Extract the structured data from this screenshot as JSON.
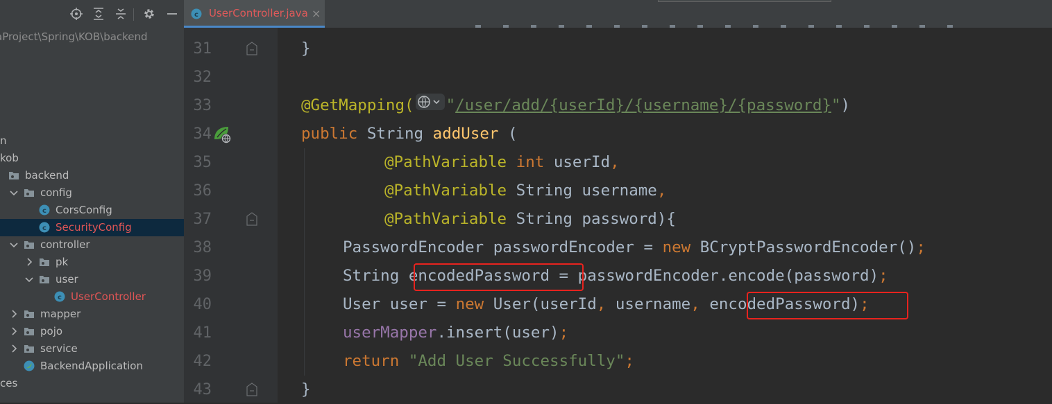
{
  "project_panel": {
    "root_path": "aProject\\Spring\\KOB\\backend",
    "tree": [
      {
        "label": "n",
        "indent": 0,
        "arrow": "none",
        "icon": "none",
        "selected": false,
        "error": false
      },
      {
        "label": "kob",
        "indent": 0,
        "arrow": "none",
        "icon": "none",
        "selected": false,
        "error": false
      },
      {
        "label": "backend",
        "indent": 0,
        "arrow": "none",
        "icon": "package",
        "selected": false,
        "error": false
      },
      {
        "label": "config",
        "indent": 1,
        "arrow": "expanded",
        "icon": "package",
        "selected": false,
        "error": false
      },
      {
        "label": "CorsConfig",
        "indent": 2,
        "arrow": "none",
        "icon": "class",
        "selected": false,
        "error": false
      },
      {
        "label": "SecurityConfig",
        "indent": 2,
        "arrow": "none",
        "icon": "class",
        "selected": true,
        "error": true
      },
      {
        "label": "controller",
        "indent": 1,
        "arrow": "expanded",
        "icon": "package",
        "selected": false,
        "error": false
      },
      {
        "label": "pk",
        "indent": 2,
        "arrow": "collapsed",
        "icon": "package",
        "selected": false,
        "error": false
      },
      {
        "label": "user",
        "indent": 2,
        "arrow": "expanded",
        "icon": "package",
        "selected": false,
        "error": false
      },
      {
        "label": "UserController",
        "indent": 3,
        "arrow": "none",
        "icon": "class",
        "selected": false,
        "error": true
      },
      {
        "label": "mapper",
        "indent": 1,
        "arrow": "collapsed",
        "icon": "package",
        "selected": false,
        "error": false
      },
      {
        "label": "pojo",
        "indent": 1,
        "arrow": "collapsed",
        "icon": "package",
        "selected": false,
        "error": false
      },
      {
        "label": "service",
        "indent": 1,
        "arrow": "collapsed",
        "icon": "package",
        "selected": false,
        "error": false
      },
      {
        "label": "BackendApplication",
        "indent": 1,
        "arrow": "none",
        "icon": "spring-app",
        "selected": false,
        "error": false
      },
      {
        "label": "ces",
        "indent": 0,
        "arrow": "none",
        "icon": "none",
        "selected": false,
        "error": false
      }
    ]
  },
  "editor": {
    "tab": {
      "label": "UserController.java",
      "close": "×"
    },
    "line_numbers": [
      "31",
      "32",
      "33",
      "34",
      "35",
      "36",
      "37",
      "38",
      "39",
      "40",
      "41",
      "42",
      "43"
    ],
    "code": [
      {
        "line": "31",
        "indent": 0,
        "tokens": [
          {
            "t": "}",
            "c": ""
          }
        ]
      },
      {
        "line": "32",
        "indent": 0,
        "tokens": []
      },
      {
        "line": "33",
        "indent": 0,
        "tokens": [
          {
            "t": "@GetMapping(",
            "c": "ann"
          },
          {
            "t": "\"",
            "c": "str"
          },
          {
            "t": "/user/add/{userId}/{username}/{password}",
            "c": "str url"
          },
          {
            "t": "\"",
            "c": "str"
          },
          {
            "t": ")",
            "c": ""
          }
        ]
      },
      {
        "line": "34",
        "indent": 0,
        "tokens": [
          {
            "t": "public ",
            "c": "kw"
          },
          {
            "t": "String ",
            "c": ""
          },
          {
            "t": "addUser",
            "c": "fn"
          },
          {
            "t": " (",
            "c": ""
          }
        ]
      },
      {
        "line": "35",
        "indent": 2,
        "tokens": [
          {
            "t": "@PathVariable ",
            "c": "ann"
          },
          {
            "t": "int ",
            "c": "kw"
          },
          {
            "t": "userId",
            "c": ""
          },
          {
            "t": ",",
            "c": "kw"
          }
        ]
      },
      {
        "line": "36",
        "indent": 2,
        "tokens": [
          {
            "t": "@PathVariable ",
            "c": "ann"
          },
          {
            "t": "String username",
            "c": ""
          },
          {
            "t": ",",
            "c": "kw"
          }
        ]
      },
      {
        "line": "37",
        "indent": 2,
        "tokens": [
          {
            "t": "@PathVariable ",
            "c": "ann"
          },
          {
            "t": "String password){",
            "c": ""
          }
        ]
      },
      {
        "line": "38",
        "indent": 1,
        "tokens": [
          {
            "t": "PasswordEncoder passwordEncoder = ",
            "c": ""
          },
          {
            "t": "new ",
            "c": "kw"
          },
          {
            "t": "BCryptPasswordEncoder()",
            "c": ""
          },
          {
            "t": ";",
            "c": "kw"
          }
        ]
      },
      {
        "line": "39",
        "indent": 1,
        "tokens": [
          {
            "t": "String encodedPassword = passwordEncoder.encode(password)",
            "c": ""
          },
          {
            "t": ";",
            "c": "kw"
          }
        ]
      },
      {
        "line": "40",
        "indent": 1,
        "tokens": [
          {
            "t": "User user = ",
            "c": ""
          },
          {
            "t": "new ",
            "c": "kw"
          },
          {
            "t": "User(userId",
            "c": ""
          },
          {
            "t": ", ",
            "c": "kw"
          },
          {
            "t": "username",
            "c": ""
          },
          {
            "t": ", ",
            "c": "kw"
          },
          {
            "t": "encodedPassword)",
            "c": ""
          },
          {
            "t": ";",
            "c": "kw"
          }
        ]
      },
      {
        "line": "41",
        "indent": 1,
        "tokens": [
          {
            "t": "userMapper",
            "c": "field"
          },
          {
            "t": ".insert(user)",
            "c": ""
          },
          {
            "t": ";",
            "c": "kw"
          }
        ]
      },
      {
        "line": "42",
        "indent": 1,
        "tokens": [
          {
            "t": "return ",
            "c": "kw"
          },
          {
            "t": "\"Add User Successfully\"",
            "c": "str"
          },
          {
            "t": ";",
            "c": "kw"
          }
        ]
      },
      {
        "line": "43",
        "indent": 0,
        "tokens": [
          {
            "t": "}",
            "c": ""
          }
        ]
      }
    ],
    "gutter_marks": {
      "web_endpoint_line": "34",
      "fold_lines": [
        "31",
        "37",
        "43"
      ]
    },
    "highlight_color": "#e8231e"
  },
  "colors": {
    "keyword": "#cc7832",
    "annotation": "#bbb529",
    "method": "#ffc66d",
    "string": "#6a8759",
    "field": "#9876aa",
    "text": "#a9b7c6",
    "error_file": "#e05555",
    "selection": "#0d293e"
  }
}
